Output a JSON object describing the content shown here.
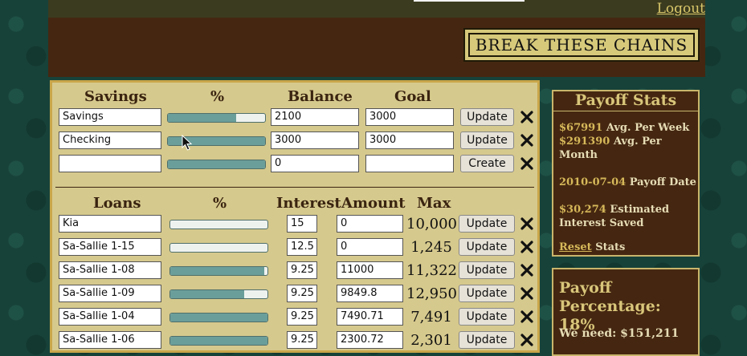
{
  "nav": {
    "logout": "Logout"
  },
  "header": {
    "cta": "BREAK THESE CHAINS"
  },
  "savings": {
    "headers": {
      "name": "Savings",
      "percent": "%",
      "balance": "Balance",
      "goal": "Goal"
    },
    "rows": [
      {
        "name": "Savings",
        "progress": 0.7,
        "balance": "2100",
        "goal": "3000",
        "action": "Update"
      },
      {
        "name": "Checking",
        "progress": 1.0,
        "balance": "3000",
        "goal": "3000",
        "action": "Update"
      },
      {
        "name": "",
        "progress": 1.0,
        "balance": "0",
        "goal": "",
        "action": "Create"
      }
    ]
  },
  "loans": {
    "headers": {
      "name": "Loans",
      "percent": "%",
      "interest": "Interest",
      "amount": "Amount",
      "max": "Max"
    },
    "rows": [
      {
        "name": "Kia",
        "progress": 0.0,
        "interest": "15",
        "amount": "0",
        "max": "10,000",
        "action": "Update"
      },
      {
        "name": "Sa-Sallie 1-15",
        "progress": 0.0,
        "interest": "12.5",
        "amount": "0",
        "max": "1,245",
        "action": "Update"
      },
      {
        "name": "Sa-Sallie 1-08",
        "progress": 0.97,
        "interest": "9.25",
        "amount": "11000",
        "max": "11,322",
        "action": "Update"
      },
      {
        "name": "Sa-Sallie 1-09",
        "progress": 0.76,
        "interest": "9.25",
        "amount": "9849.8",
        "max": "12,950",
        "action": "Update"
      },
      {
        "name": "Sa-Sallie 1-04",
        "progress": 1.0,
        "interest": "9.25",
        "amount": "7490.71",
        "max": "7,491",
        "action": "Update"
      },
      {
        "name": "Sa-Sallie 1-06",
        "progress": 1.0,
        "interest": "9.25",
        "amount": "2300.72",
        "max": "2,301",
        "action": "Update"
      }
    ]
  },
  "stats": {
    "title": "Payoff Stats",
    "avg_week_value": "$67991",
    "avg_week_label": "Avg. Per Week",
    "avg_month_value": "$291390",
    "avg_month_label": "Avg. Per Month",
    "payoff_date_value": "2010-07-04",
    "payoff_date_label": "Payoff Date",
    "interest_value": "$30,274",
    "interest_label": "Estimated Interest Saved",
    "reset_link": "Reset",
    "reset_label": "Stats"
  },
  "percentage": {
    "title": "Payoff Percentage: 18%",
    "need": "We need: $151,211"
  },
  "colors": {
    "accent": "#6a9e9a",
    "brown": "#452711",
    "tan": "#d6c98d",
    "gold": "#d6b85a"
  }
}
